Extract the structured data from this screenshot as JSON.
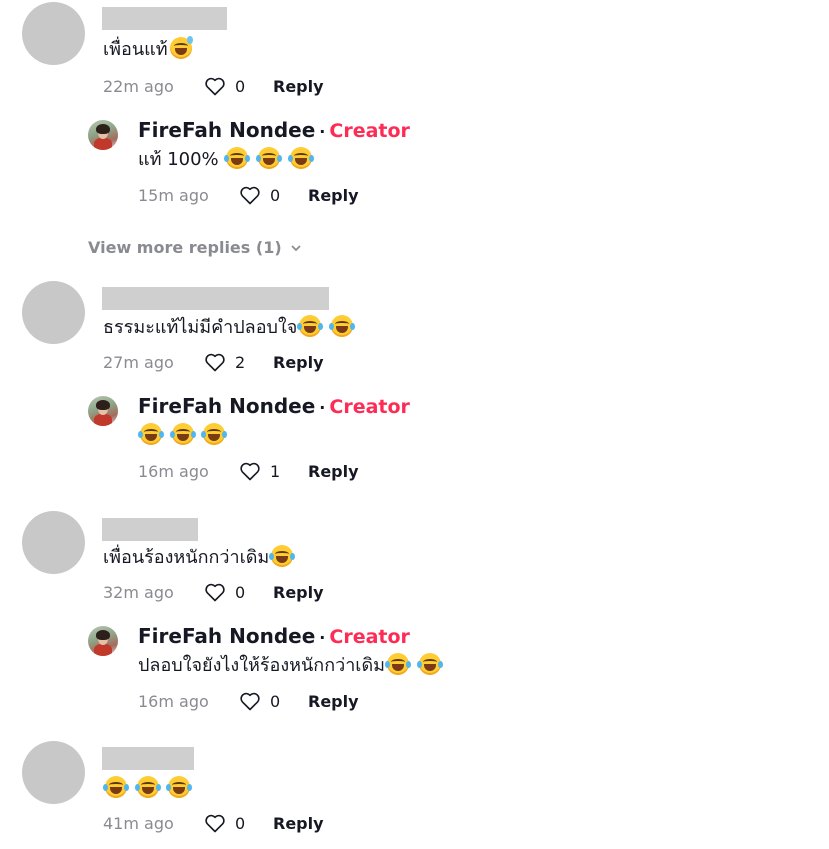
{
  "comments": [
    {
      "text": "เพื่อนแท้",
      "emoji_after": [
        "sweat-smile"
      ],
      "time": "22m ago",
      "likes": "0",
      "reply_label": "Reply",
      "reply": {
        "name": "FireFah Nondee",
        "separator": "·",
        "badge": "Creator",
        "text": "แท้ 100%",
        "emoji_after": [
          "joy",
          "joy",
          "joy"
        ],
        "time": "15m ago",
        "likes": "0",
        "reply_label": "Reply"
      },
      "view_more": "View more replies (1)"
    },
    {
      "text": "ธรรมะแท้ไม่มีคำปลอบใจ",
      "emoji_after": [
        "joy",
        "joy"
      ],
      "time": "27m ago",
      "likes": "2",
      "reply_label": "Reply",
      "reply": {
        "name": "FireFah Nondee",
        "separator": "·",
        "badge": "Creator",
        "text": "",
        "emoji_after": [
          "joy",
          "joy",
          "joy"
        ],
        "time": "16m ago",
        "likes": "1",
        "reply_label": "Reply"
      }
    },
    {
      "text": "เพื่อนร้องหนักกว่าเดิม",
      "emoji_after": [
        "joy"
      ],
      "time": "32m ago",
      "likes": "0",
      "reply_label": "Reply",
      "reply": {
        "name": "FireFah Nondee",
        "separator": "·",
        "badge": "Creator",
        "text": "ปลอบใจยังไงให้ร้องหนักกว่าเดิม",
        "emoji_after": [
          "joy",
          "joy"
        ],
        "time": "16m ago",
        "likes": "0",
        "reply_label": "Reply"
      }
    },
    {
      "text": "",
      "emoji_after": [
        "joy",
        "joy",
        "joy"
      ],
      "time": "41m ago",
      "likes": "0",
      "reply_label": "Reply"
    }
  ],
  "colors": {
    "creator": "#fe2c55",
    "meta": "#8a8b91",
    "text": "#161823",
    "placeholder": "#c8c8c8"
  },
  "icons": {
    "like": "heart-outline-icon",
    "expand": "chevron-down-icon"
  }
}
